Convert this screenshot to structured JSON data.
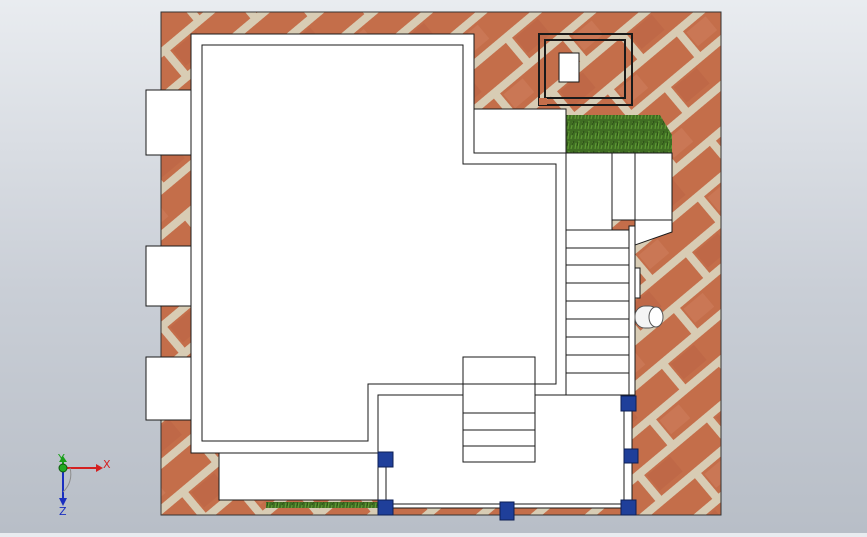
{
  "viewport": {
    "background_top": "#e9ecf0",
    "background_bottom": "#b8bec7"
  },
  "model": {
    "brick_color": "#c2714f",
    "mortar_color": "#d9cfb8",
    "grass_color": "#3e6e22",
    "wall_color": "#ffffff",
    "outline_color": "#1a1a1a",
    "column_color": "#1f3f9a"
  },
  "triad": {
    "x_label": "X",
    "y_label": "Y",
    "z_label": "Z",
    "x_color": "#d42020",
    "y_color": "#1aa01a",
    "z_color": "#1a2fc0"
  }
}
